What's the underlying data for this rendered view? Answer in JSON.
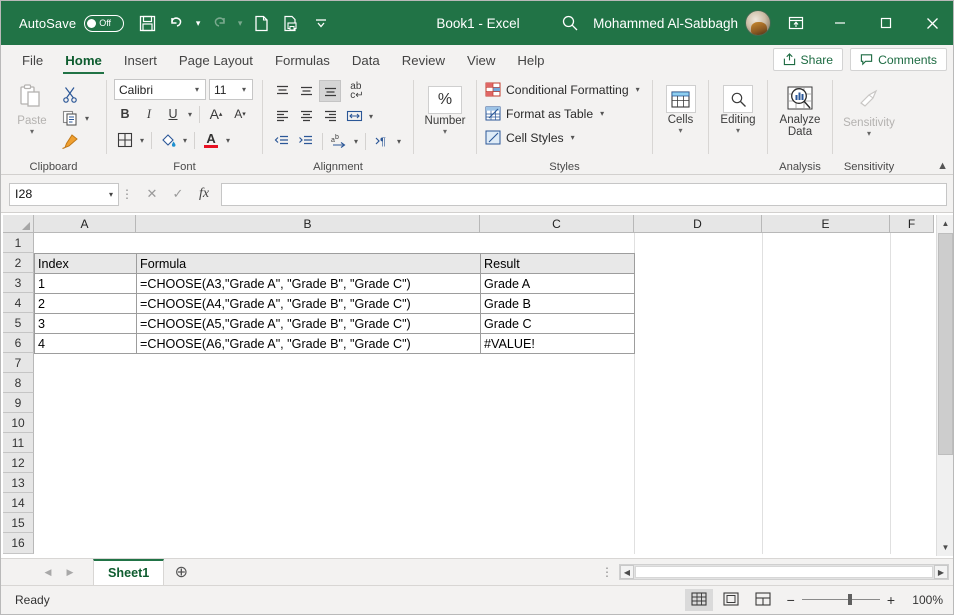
{
  "titlebar": {
    "autosave_label": "AutoSave",
    "autosave_state": "Off",
    "doc_title": "Book1  -  Excel",
    "account_name": "Mohammed Al-Sabbagh",
    "icons": [
      "save-icon",
      "undo-icon",
      "redo-icon",
      "new-icon",
      "print-preview-icon",
      "customize-qat-icon"
    ],
    "window_buttons": {
      "minimize": "—",
      "maximize": "☐",
      "close": "✕"
    }
  },
  "tabs": [
    {
      "label": "File",
      "active": false
    },
    {
      "label": "Home",
      "active": true
    },
    {
      "label": "Insert",
      "active": false
    },
    {
      "label": "Page Layout",
      "active": false
    },
    {
      "label": "Formulas",
      "active": false
    },
    {
      "label": "Data",
      "active": false
    },
    {
      "label": "Review",
      "active": false
    },
    {
      "label": "View",
      "active": false
    },
    {
      "label": "Help",
      "active": false
    }
  ],
  "tabstrip_actions": {
    "share": "Share",
    "comments": "Comments"
  },
  "ribbon": {
    "clipboard": {
      "group_label": "Clipboard",
      "paste_label": "Paste",
      "cut_label": "",
      "copy_label": "",
      "format_painter_label": ""
    },
    "font": {
      "group_label": "Font",
      "font_name": "Calibri",
      "font_size": "11",
      "bold": "B",
      "italic": "I",
      "underline": "U",
      "grow_font": "A",
      "shrink_font": "A"
    },
    "alignment": {
      "group_label": "Alignment",
      "wrap_text": "ab"
    },
    "number": {
      "group_label": "",
      "button_label": "Number",
      "symbol": "%"
    },
    "styles": {
      "group_label": "Styles",
      "items": [
        "Conditional Formatting",
        "Format as Table",
        "Cell Styles"
      ]
    },
    "cells": {
      "group_label": "",
      "button_label": "Cells"
    },
    "editing": {
      "group_label": "",
      "button_label": "Editing"
    },
    "analysis": {
      "group_label": "Analysis",
      "button_label": "Analyze Data"
    },
    "sensitivity": {
      "group_label": "Sensitivity",
      "button_label": "Sensitivity"
    }
  },
  "formula_bar": {
    "name_box": "I28",
    "cancel_icon": "✕",
    "enter_icon": "✓",
    "function_icon": "fx",
    "formula_value": "",
    "formula_placeholder": ""
  },
  "grid": {
    "columns": [
      "A",
      "B",
      "C",
      "D",
      "E",
      "F"
    ],
    "rows": [
      "1",
      "2",
      "3",
      "4",
      "5",
      "6",
      "7",
      "8",
      "9",
      "10",
      "11",
      "12",
      "13",
      "14",
      "15",
      "16"
    ],
    "cells": [
      {
        "row": 2,
        "col": "A",
        "value": "Index",
        "header": true
      },
      {
        "row": 2,
        "col": "B",
        "value": "Formula",
        "header": true
      },
      {
        "row": 2,
        "col": "C",
        "value": "Result",
        "header": true
      },
      {
        "row": 3,
        "col": "A",
        "value": "1"
      },
      {
        "row": 3,
        "col": "B",
        "value": "=CHOOSE(A3,\"Grade A\", \"Grade B\", \"Grade C\")"
      },
      {
        "row": 3,
        "col": "C",
        "value": "Grade A"
      },
      {
        "row": 4,
        "col": "A",
        "value": "2"
      },
      {
        "row": 4,
        "col": "B",
        "value": "=CHOOSE(A4,\"Grade A\", \"Grade B\", \"Grade C\")"
      },
      {
        "row": 4,
        "col": "C",
        "value": "Grade B"
      },
      {
        "row": 5,
        "col": "A",
        "value": "3"
      },
      {
        "row": 5,
        "col": "B",
        "value": "=CHOOSE(A5,\"Grade A\", \"Grade B\", \"Grade C\")"
      },
      {
        "row": 5,
        "col": "C",
        "value": "Grade C"
      },
      {
        "row": 6,
        "col": "A",
        "value": "4"
      },
      {
        "row": 6,
        "col": "B",
        "value": "=CHOOSE(A6,\"Grade A\", \"Grade B\", \"Grade C\")"
      },
      {
        "row": 6,
        "col": "C",
        "value": "#VALUE!"
      }
    ]
  },
  "sheetbar": {
    "sheet_name": "Sheet1",
    "add_sheet_icon": "⊕"
  },
  "statusbar": {
    "status_text": "Ready",
    "zoom_label": "100%",
    "zoom_out": "−",
    "zoom_in": "+",
    "views": [
      "normal-view",
      "page-layout-view",
      "page-break-view"
    ]
  },
  "colors": {
    "excel_green": "#217346",
    "accent_text": "#0e5c2f",
    "ribbon_bg": "#f3f2f1",
    "grid_line": "#e0e0e0"
  }
}
